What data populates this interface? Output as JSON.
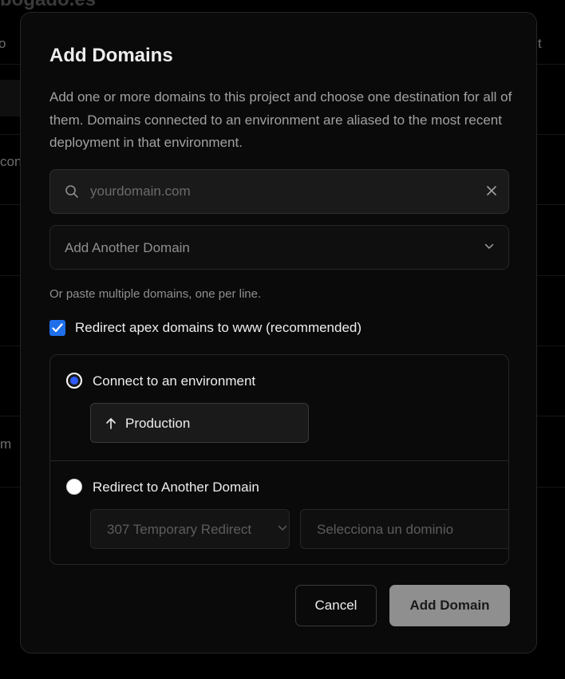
{
  "background": {
    "title_fragment": "bogado.es",
    "left_fragments": [
      "o",
      "con",
      "m"
    ],
    "right_fragment": "t"
  },
  "modal": {
    "title": "Add Domains",
    "description": "Add one or more domains to this project and choose one destination for all of them. Domains connected to an environment are aliased to the most recent deployment in that environment.",
    "search": {
      "placeholder": "yourdomain.com",
      "value": ""
    },
    "add_another_label": "Add Another Domain",
    "paste_hint": "Or paste multiple domains, one per line.",
    "redirect_apex": {
      "label": "Redirect apex domains to www (recommended)",
      "checked": true
    },
    "destination": {
      "connect_label": "Connect to an environment",
      "environment": "Production",
      "redirect_label": "Redirect to Another Domain",
      "redirect_type": "307 Temporary Redirect",
      "domain_select_placeholder": "Selecciona un dominio"
    },
    "buttons": {
      "cancel": "Cancel",
      "add": "Add Domain"
    }
  },
  "colors": {
    "accent_blue": "#2f5bff",
    "checkbox_blue": "#1f6feb",
    "primary_disabled": "#8f8f8f",
    "modal_bg": "#0a0a0a"
  },
  "icons": [
    "search-icon",
    "close-icon",
    "chevron-down-icon",
    "check-icon",
    "arrow-up-icon"
  ]
}
